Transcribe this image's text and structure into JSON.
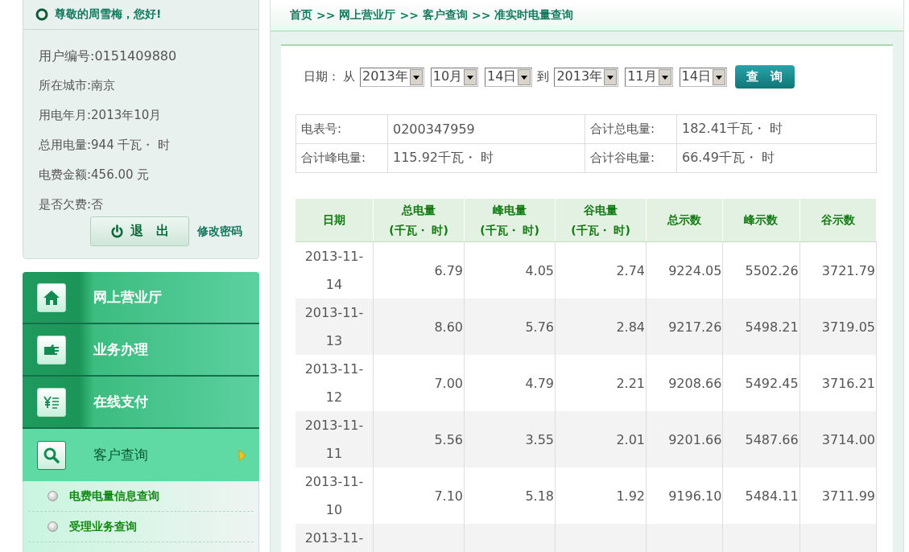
{
  "greeting": "尊敬的周雪梅，您好!",
  "account_info": [
    "用户编号:0151409880",
    "所在城市:南京",
    "用电年月:2013年10月",
    "总用电量:944 千瓦・ 时",
    "电费金额:456.00 元",
    "是否欠费:否"
  ],
  "logout_button": "退　出",
  "change_password_link": "修改密码",
  "menu": [
    {
      "label": "网上营业厅",
      "selected": false
    },
    {
      "label": "业务办理",
      "selected": false
    },
    {
      "label": "在线支付",
      "selected": false
    },
    {
      "label": "客户查询",
      "selected": true
    }
  ],
  "submenu": [
    "电费电量信息查询",
    "受理业务查询"
  ],
  "breadcrumb": {
    "separator": ">>",
    "items": [
      "首页",
      "网上营业厅",
      "客户查询",
      "准实时电量查询"
    ]
  },
  "date_filter": {
    "label": "日期：",
    "from_label": "从",
    "from": [
      "2013年",
      "10月",
      "14日"
    ],
    "to_label": "到",
    "to": [
      "2013年",
      "11月",
      "14日"
    ],
    "query_button": "查　询"
  },
  "summary": [
    [
      "电表号:",
      "0200347959",
      "合计总电量:",
      "182.41千瓦・ 时"
    ],
    [
      "合计峰电量:",
      "115.92千瓦・ 时",
      "合计谷电量:",
      "66.49千瓦・ 时"
    ]
  ],
  "table": {
    "columns": [
      "日期",
      "总电量\n(千瓦・ 时)",
      "峰电量\n(千瓦・ 时)",
      "谷电量\n(千瓦・ 时)",
      "总示数",
      "峰示数",
      "谷示数"
    ],
    "rows": [
      [
        "2013-11-14",
        "6.79",
        "4.05",
        "2.74",
        "9224.05",
        "5502.26",
        "3721.79"
      ],
      [
        "2013-11-13",
        "8.60",
        "5.76",
        "2.84",
        "9217.26",
        "5498.21",
        "3719.05"
      ],
      [
        "2013-11-12",
        "7.00",
        "4.79",
        "2.21",
        "9208.66",
        "5492.45",
        "3716.21"
      ],
      [
        "2013-11-11",
        "5.56",
        "3.55",
        "2.01",
        "9201.66",
        "5487.66",
        "3714.00"
      ],
      [
        "2013-11-10",
        "7.10",
        "5.18",
        "1.92",
        "9196.10",
        "5484.11",
        "3711.99"
      ],
      [
        "2013-11-"
      ]
    ]
  }
}
